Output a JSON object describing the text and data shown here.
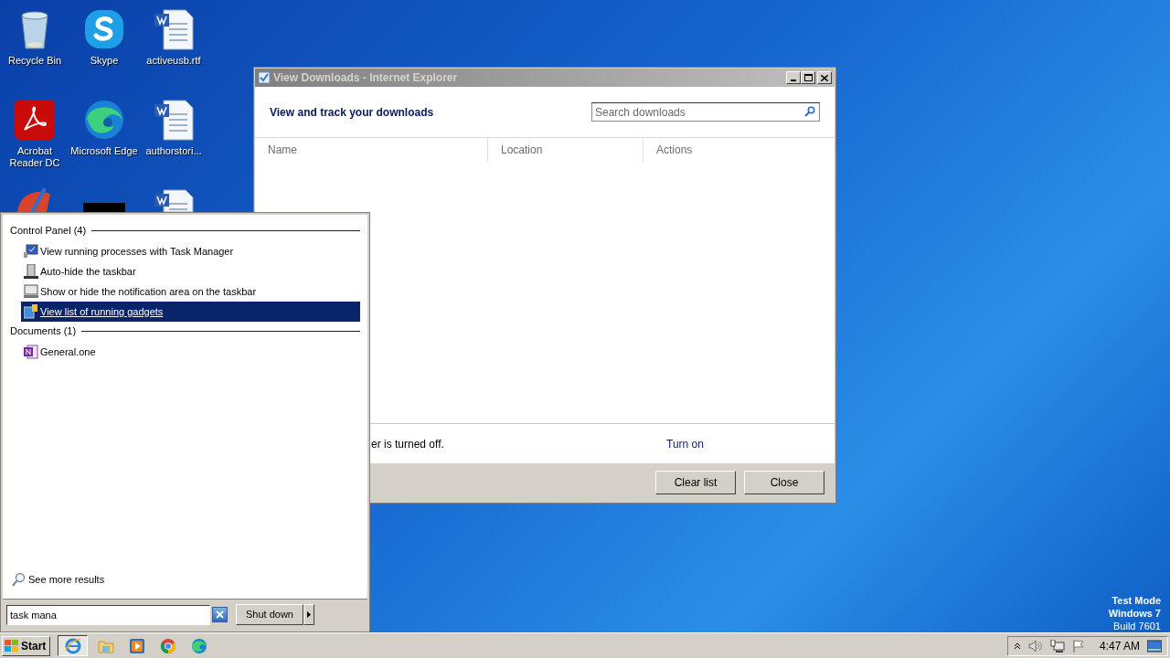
{
  "desktop_icons": [
    {
      "kind": "recycle",
      "label_lines": [
        "Recycle Bin"
      ]
    },
    {
      "kind": "skype",
      "label_lines": [
        "Skype"
      ]
    },
    {
      "kind": "word",
      "label_lines": [
        "activeusb.rtf"
      ]
    },
    {
      "kind": "acrobat",
      "label_lines": [
        "Acrobat",
        "Reader DC"
      ]
    },
    {
      "kind": "edge",
      "label_lines": [
        "Microsoft Edge"
      ]
    },
    {
      "kind": "word",
      "label_lines": [
        "authorstori..."
      ]
    },
    {
      "kind": "brush"
    },
    {
      "kind": "black"
    },
    {
      "kind": "word"
    }
  ],
  "downloads_window": {
    "title": "View Downloads - Internet Explorer",
    "heading": "View and track your downloads",
    "search": {
      "placeholder": "Search downloads"
    },
    "columns": [
      "Name",
      "Location",
      "Actions"
    ],
    "notice": "er is turned off.",
    "link": "Turn on",
    "buttons": [
      "Clear list",
      "Close"
    ]
  },
  "start_menu": {
    "groups": [
      {
        "title": "Control Panel (4)",
        "items": [
          {
            "kind": "monitor",
            "label": "View running processes with Task Manager",
            "selected": false
          },
          {
            "kind": "tower",
            "label": "Auto-hide the taskbar",
            "selected": false
          },
          {
            "kind": "screen",
            "label": "Show or hide the notification area on the taskbar",
            "selected": false
          },
          {
            "kind": "gadget",
            "label": "View list of running gadgets",
            "selected": true
          }
        ]
      },
      {
        "title": "Documents (1)",
        "items": [
          {
            "kind": "onenote",
            "label": "General.one",
            "selected": false
          }
        ]
      }
    ],
    "more_results": "See more results",
    "search": {
      "value": "task mana"
    },
    "shutdown": "Shut down"
  },
  "taskbar": {
    "start": "Start",
    "apps": [
      {
        "kind": "ie",
        "active": true
      },
      {
        "kind": "folder",
        "active": false
      },
      {
        "kind": "media",
        "active": false
      },
      {
        "kind": "chrome",
        "active": false
      },
      {
        "kind": "edge",
        "active": false
      }
    ],
    "clock": "4:47 AM"
  },
  "system_notice": [
    "Test Mode",
    "Windows 7",
    "Build 7601"
  ]
}
